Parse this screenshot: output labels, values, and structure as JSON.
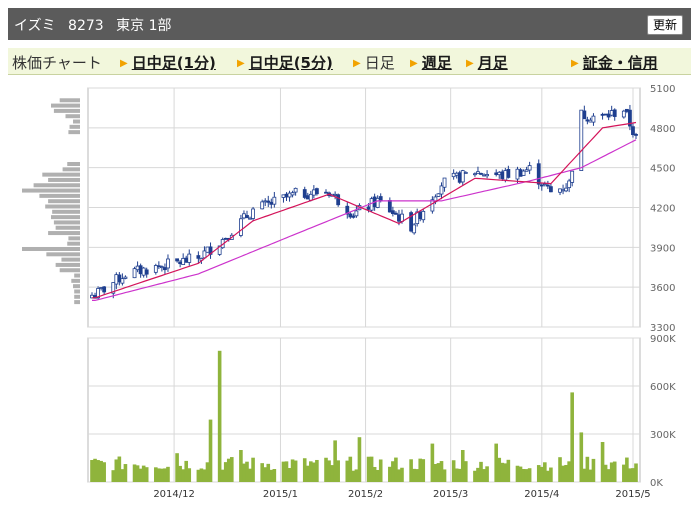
{
  "header": {
    "name": "イズミ",
    "code": "8273",
    "market": "東京 1部",
    "refresh_label": "更新"
  },
  "tabs": [
    {
      "label": "株価チャート",
      "arrow": false,
      "link": false
    },
    {
      "label": "日中足(1分)",
      "arrow": true,
      "link": true
    },
    {
      "label": "日中足(5分)",
      "arrow": true,
      "link": true
    },
    {
      "label": "日足",
      "arrow": true,
      "link": false
    },
    {
      "label": "週足",
      "arrow": true,
      "link": true
    },
    {
      "label": "月足",
      "arrow": true,
      "link": true
    },
    {
      "label": "証金・信用",
      "arrow": true,
      "link": true
    }
  ],
  "colors": {
    "up_candle": "#ffffff",
    "down_candle": "#1f3f8f",
    "candle_outline": "#1f3f8f",
    "ma_short": "#d4145a",
    "ma_long": "#cc33cc",
    "volume_bar": "#8fb43c",
    "volume_profile": "#b0b0b0",
    "grid": "#d8d8d8",
    "header_bg": "#5b5b5b",
    "tab_bg": "#f2f7dc"
  },
  "chart_data": [
    {
      "type": "candlestick",
      "title": "",
      "ylim": [
        3300,
        5100
      ],
      "yticks": [
        3300,
        3600,
        3900,
        4200,
        4500,
        4800,
        5100
      ],
      "xticks": [
        "2014/12",
        "2015/1",
        "2015/2",
        "2015/3",
        "2015/4",
        "2015/5"
      ],
      "grid": true,
      "close_trend": [
        {
          "x": "2014/11/04",
          "y": 3540
        },
        {
          "x": "2014/11/14",
          "y": 3700
        },
        {
          "x": "2014/11/26",
          "y": 3760
        },
        {
          "x": "2014/12/08",
          "y": 3820
        },
        {
          "x": "2014/12/16",
          "y": 3960
        },
        {
          "x": "2014/12/26",
          "y": 4180
        },
        {
          "x": "2015/01/09",
          "y": 4300
        },
        {
          "x": "2015/01/20",
          "y": 4320
        },
        {
          "x": "2015/01/28",
          "y": 4150
        },
        {
          "x": "2015/02/05",
          "y": 4250
        },
        {
          "x": "2015/02/16",
          "y": 4060
        },
        {
          "x": "2015/02/26",
          "y": 4380
        },
        {
          "x": "2015/03/09",
          "y": 4470
        },
        {
          "x": "2015/03/18",
          "y": 4440
        },
        {
          "x": "2015/03/27",
          "y": 4490
        },
        {
          "x": "2015/04/03",
          "y": 4310
        },
        {
          "x": "2015/04/09",
          "y": 4380
        },
        {
          "x": "2015/04/13",
          "y": 4900
        },
        {
          "x": "2015/04/20",
          "y": 4880
        },
        {
          "x": "2015/04/27",
          "y": 4940
        },
        {
          "x": "2015/05/01",
          "y": 4720
        }
      ],
      "ma_short_trend": [
        {
          "x": "2014/11/04",
          "y": 3520
        },
        {
          "x": "2014/12/08",
          "y": 3780
        },
        {
          "x": "2014/12/26",
          "y": 4100
        },
        {
          "x": "2015/01/20",
          "y": 4300
        },
        {
          "x": "2015/02/12",
          "y": 4080
        },
        {
          "x": "2015/03/09",
          "y": 4420
        },
        {
          "x": "2015/04/03",
          "y": 4380
        },
        {
          "x": "2015/04/20",
          "y": 4800
        },
        {
          "x": "2015/05/01",
          "y": 4840
        }
      ],
      "ma_long_trend": [
        {
          "x": "2014/11/04",
          "y": 3500
        },
        {
          "x": "2014/12/08",
          "y": 3700
        },
        {
          "x": "2015/01/09",
          "y": 4000
        },
        {
          "x": "2015/02/05",
          "y": 4250
        },
        {
          "x": "2015/02/26",
          "y": 4250
        },
        {
          "x": "2015/03/27",
          "y": 4400
        },
        {
          "x": "2015/04/13",
          "y": 4500
        },
        {
          "x": "2015/05/01",
          "y": 4710
        }
      ],
      "volume_profile": [
        {
          "price": 3480,
          "w": 0.1
        },
        {
          "price": 3520,
          "w": 0.1
        },
        {
          "price": 3560,
          "w": 0.1
        },
        {
          "price": 3600,
          "w": 0.12
        },
        {
          "price": 3640,
          "w": 0.15
        },
        {
          "price": 3680,
          "w": 0.1
        },
        {
          "price": 3720,
          "w": 0.35
        },
        {
          "price": 3760,
          "w": 0.42
        },
        {
          "price": 3800,
          "w": 0.32
        },
        {
          "price": 3840,
          "w": 0.58
        },
        {
          "price": 3880,
          "w": 1.0
        },
        {
          "price": 3920,
          "w": 0.22
        },
        {
          "price": 3960,
          "w": 0.2
        },
        {
          "price": 4000,
          "w": 0.55
        },
        {
          "price": 4040,
          "w": 0.42
        },
        {
          "price": 4080,
          "w": 0.45
        },
        {
          "price": 4120,
          "w": 0.5
        },
        {
          "price": 4160,
          "w": 0.48
        },
        {
          "price": 4200,
          "w": 0.6
        },
        {
          "price": 4240,
          "w": 0.55
        },
        {
          "price": 4280,
          "w": 0.7
        },
        {
          "price": 4320,
          "w": 1.0
        },
        {
          "price": 4360,
          "w": 0.8
        },
        {
          "price": 4400,
          "w": 0.55
        },
        {
          "price": 4440,
          "w": 0.65
        },
        {
          "price": 4480,
          "w": 0.3
        },
        {
          "price": 4520,
          "w": 0.22
        },
        {
          "price": 4760,
          "w": 0.2
        },
        {
          "price": 4800,
          "w": 0.18
        },
        {
          "price": 4840,
          "w": 0.12
        },
        {
          "price": 4880,
          "w": 0.25
        },
        {
          "price": 4920,
          "w": 0.45
        },
        {
          "price": 4960,
          "w": 0.5
        },
        {
          "price": 5000,
          "w": 0.35
        }
      ]
    },
    {
      "type": "bar",
      "title": "",
      "ylim": [
        0,
        900000
      ],
      "yticks": [
        "0K",
        "300K",
        "600K",
        "900K"
      ],
      "volume_peaks": [
        {
          "x": "2014/12/01",
          "y": 180000
        },
        {
          "x": "2014/12/12",
          "y": 390000
        },
        {
          "x": "2014/12/15",
          "y": 820000
        },
        {
          "x": "2014/12/22",
          "y": 200000
        },
        {
          "x": "2015/01/22",
          "y": 260000
        },
        {
          "x": "2015/01/30",
          "y": 280000
        },
        {
          "x": "2015/02/23",
          "y": 240000
        },
        {
          "x": "2015/03/05",
          "y": 200000
        },
        {
          "x": "2015/03/16",
          "y": 240000
        },
        {
          "x": "2015/04/10",
          "y": 560000
        },
        {
          "x": "2015/04/13",
          "y": 310000
        },
        {
          "x": "2015/04/20",
          "y": 250000
        }
      ],
      "volume_baseline": 100000
    }
  ]
}
